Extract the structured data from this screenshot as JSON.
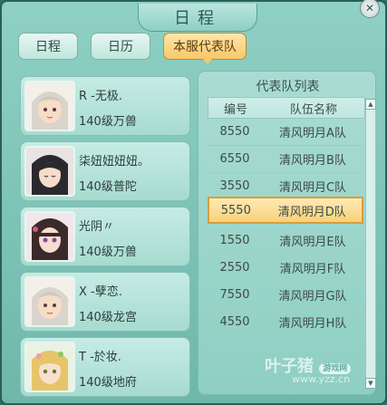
{
  "window": {
    "title": "日程"
  },
  "tabs": [
    {
      "label": "日程"
    },
    {
      "label": "日历"
    },
    {
      "label": "本服代表队"
    }
  ],
  "players": [
    {
      "name": "R -无极.",
      "level": "140级万兽"
    },
    {
      "name": "柒妞妞妞妞。",
      "level": "140级普陀"
    },
    {
      "name": "光阴〃",
      "level": "140级万兽"
    },
    {
      "name": "X -孽恋.",
      "level": "140级龙宫"
    },
    {
      "name": "T -於妆.",
      "level": "140级地府"
    }
  ],
  "teams": {
    "title": "代表队列表",
    "headers": {
      "id": "编号",
      "name": "队伍名称"
    },
    "rows": [
      {
        "id": "8550",
        "name": "清风明月A队"
      },
      {
        "id": "6550",
        "name": "清风明月B队"
      },
      {
        "id": "3550",
        "name": "清风明月C队"
      },
      {
        "id": "5550",
        "name": "清风明月D队"
      },
      {
        "id": "1550",
        "name": "清风明月E队"
      },
      {
        "id": "2550",
        "name": "清风明月F队"
      },
      {
        "id": "7550",
        "name": "清风明月G队"
      },
      {
        "id": "4550",
        "name": "清风明月H队"
      }
    ],
    "selected_index": 3
  },
  "watermark": {
    "text": "叶子猪",
    "badge": "游戏网",
    "url": "www.yzz.cn"
  },
  "colors": {
    "accent": "#f7c86b",
    "panel": "#8fd0c4"
  }
}
